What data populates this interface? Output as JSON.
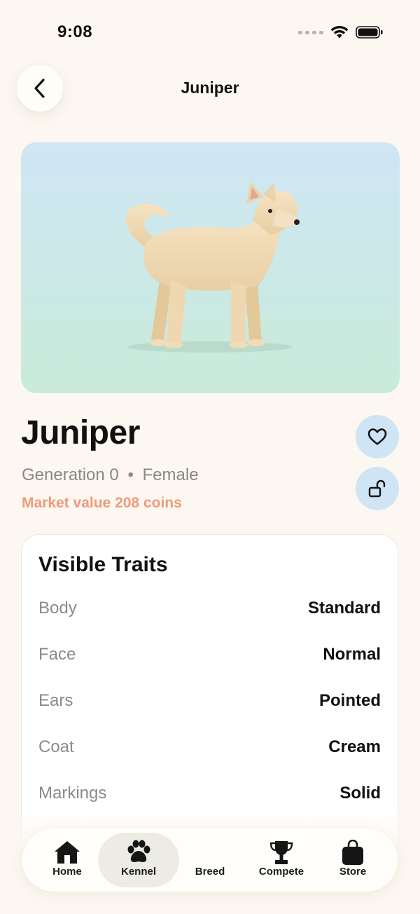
{
  "status_bar": {
    "time": "9:08"
  },
  "header": {
    "title": "Juniper",
    "back_icon": "chevron-left-icon"
  },
  "pet": {
    "name": "Juniper",
    "generation": "Generation 0",
    "separator": "•",
    "sex": "Female",
    "market_value": "Market value 208 coins",
    "favorite_icon": "heart-icon",
    "lock_icon": "unlock-icon"
  },
  "colors": {
    "background": "#fcf8f1",
    "accent_value": "#ef9a7c",
    "circle_button": "#cfe4f4",
    "hero_top": "#cfe6f5",
    "hero_bottom": "#c8ebd9"
  },
  "traits": {
    "title": "Visible Traits",
    "rows": [
      {
        "label": "Body",
        "value": "Standard"
      },
      {
        "label": "Face",
        "value": "Normal"
      },
      {
        "label": "Ears",
        "value": "Pointed"
      },
      {
        "label": "Coat",
        "value": "Cream"
      },
      {
        "label": "Markings",
        "value": "Solid"
      }
    ]
  },
  "tab_bar": {
    "tabs": [
      {
        "label": "Home",
        "icon": "house-icon",
        "active": false
      },
      {
        "label": "Kennel",
        "icon": "paw-icon",
        "active": true
      },
      {
        "label": "Breed",
        "icon": "",
        "active": false
      },
      {
        "label": "Compete",
        "icon": "trophy-icon",
        "active": false
      },
      {
        "label": "Store",
        "icon": "shopping-bag-icon",
        "active": false
      }
    ]
  }
}
